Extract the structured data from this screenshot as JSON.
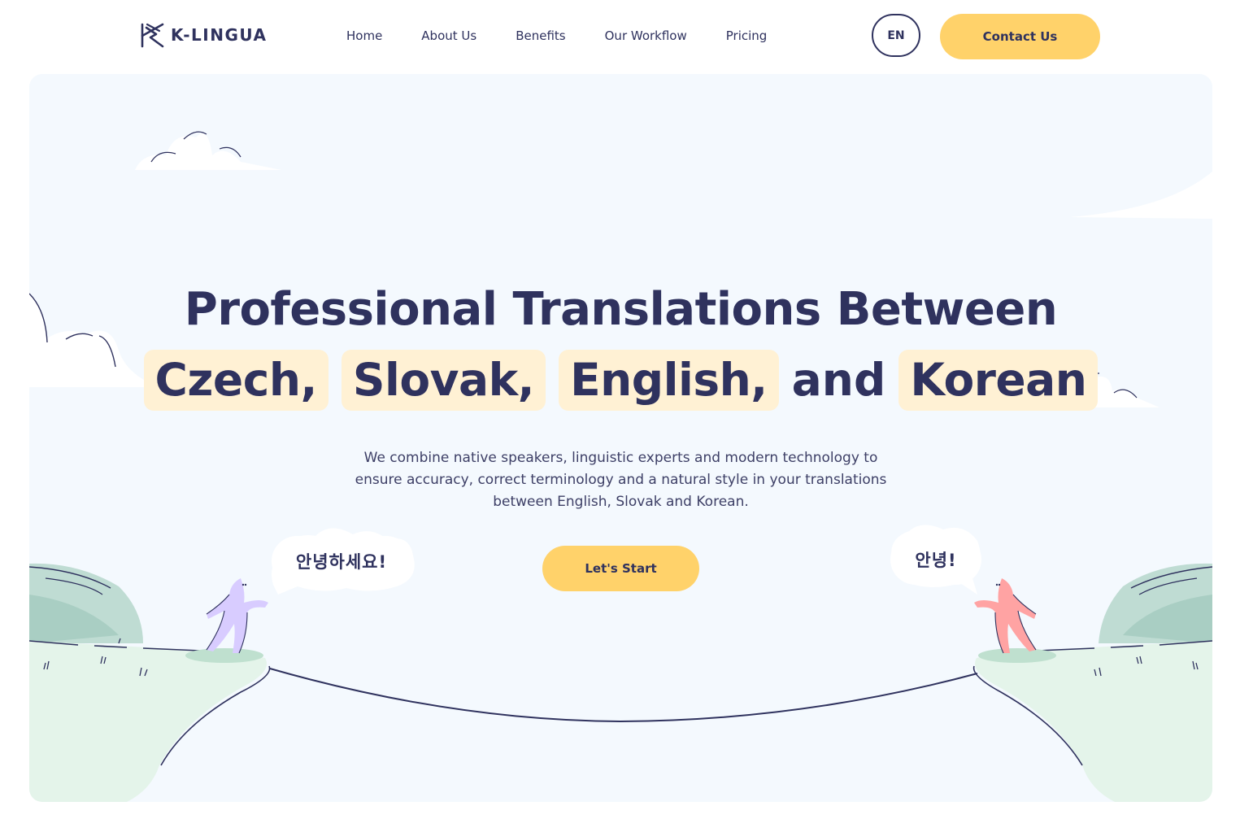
{
  "brand": {
    "name": "K-LINGUA"
  },
  "nav": {
    "items": [
      {
        "label": "Home"
      },
      {
        "label": "About Us"
      },
      {
        "label": "Benefits"
      },
      {
        "label": "Our Workflow"
      },
      {
        "label": "Pricing"
      }
    ]
  },
  "header": {
    "language": "EN",
    "contact_label": "Contact Us"
  },
  "hero": {
    "headline": "Professional Translations Between",
    "languages": [
      "Czech,",
      "Slovak,",
      "English,",
      "Korean"
    ],
    "conjunction": "and",
    "subtitle": "We combine native speakers, linguistic experts and modern technology to ensure accuracy, correct terminology and a natural style in your translations between English, Slovak and Korean.",
    "cta_label": "Let's Start",
    "greeting_left": "안녕하세요!",
    "greeting_right": "안녕!"
  },
  "colors": {
    "navy": "#2f325e",
    "accent_yellow": "#ffd26a",
    "chip_background": "#fff1d4",
    "hero_background": "#f4f9fe",
    "grass": "#e4f4ea",
    "bush": "#bfdcd3",
    "figure_left": "#d8ccff",
    "figure_right": "#ffa3a3"
  }
}
